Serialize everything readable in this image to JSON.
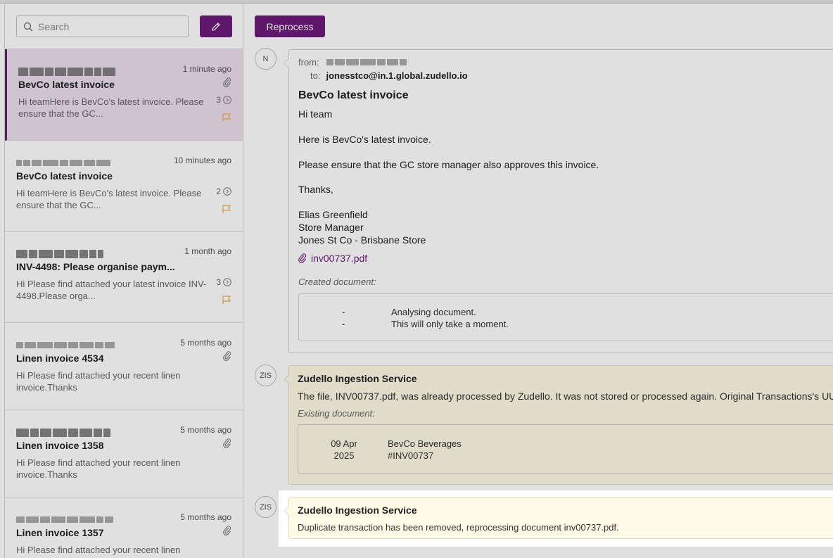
{
  "search": {
    "placeholder": "Search"
  },
  "emails": [
    {
      "time": "1 minute ago",
      "subject": "BevCo latest invoice",
      "preview": "Hi teamHere is BevCo's latest invoice. Please ensure that the GC...",
      "count": "3",
      "selected": true
    },
    {
      "time": "10 minutes ago",
      "subject": "BevCo latest invoice",
      "preview": "Hi teamHere is BevCo's latest invoice. Please ensure that the GC...",
      "count": "2"
    },
    {
      "time": "1 month ago",
      "subject": "INV-4498: Please organise paym...",
      "preview": "Hi Please find attached your latest invoice INV-4498.Please orga...",
      "count": "3"
    },
    {
      "time": "5 months ago",
      "subject": "Linen invoice 4534",
      "preview": "Hi Please find attached your recent linen invoice.Thanks"
    },
    {
      "time": "5 months ago",
      "subject": "Linen invoice 1358",
      "preview": "Hi Please find attached your recent linen invoice.Thanks"
    },
    {
      "time": "5 months ago",
      "subject": "Linen invoice 1357",
      "preview": "Hi Please find attached your recent linen invoice.Thanks Ned Bid..."
    }
  ],
  "main": {
    "reprocess_label": "Reprocess",
    "message1": {
      "avatar": "N",
      "from_label": "from:",
      "to_label": "to:",
      "to_address": "jonesstco@in.1.global.zudello.io",
      "title": "BevCo latest invoice",
      "body": {
        "greeting": "Hi team",
        "line1": "Here is BevCo's latest invoice.",
        "line2": "Please ensure that the GC store manager also approves this invoice.",
        "signoff": "Thanks,",
        "sig_name": "Elias Greenfield",
        "sig_role": "Store Manager",
        "sig_store": "Jones St Co - Brisbane Store"
      },
      "attachment": "inv00737.pdf",
      "created_label": "Created document:",
      "doc_dash": "-",
      "doc_line1": "Analysing document.",
      "doc_line2": "This will only take a moment."
    },
    "message2": {
      "avatar": "ZIS",
      "service": "Zudello Ingestion Service",
      "text": "The file, INV00737.pdf, was already processed by Zudello. It was not stored or processed again. Original Transactions's UUID:",
      "existing_label": "Existing document:",
      "doc_day": "09 Apr",
      "doc_year": "2025",
      "doc_vendor": "BevCo Beverages",
      "doc_number": "#INV00737"
    },
    "message3": {
      "avatar": "ZIS",
      "service": "Zudello Ingestion Service",
      "text": "Duplicate transaction has been removed, reprocessing document inv00737.pdf."
    }
  },
  "colors": {
    "accent": "#6d1b7b",
    "flag": "#e8b04a",
    "notice_bg": "#fffbe6"
  }
}
